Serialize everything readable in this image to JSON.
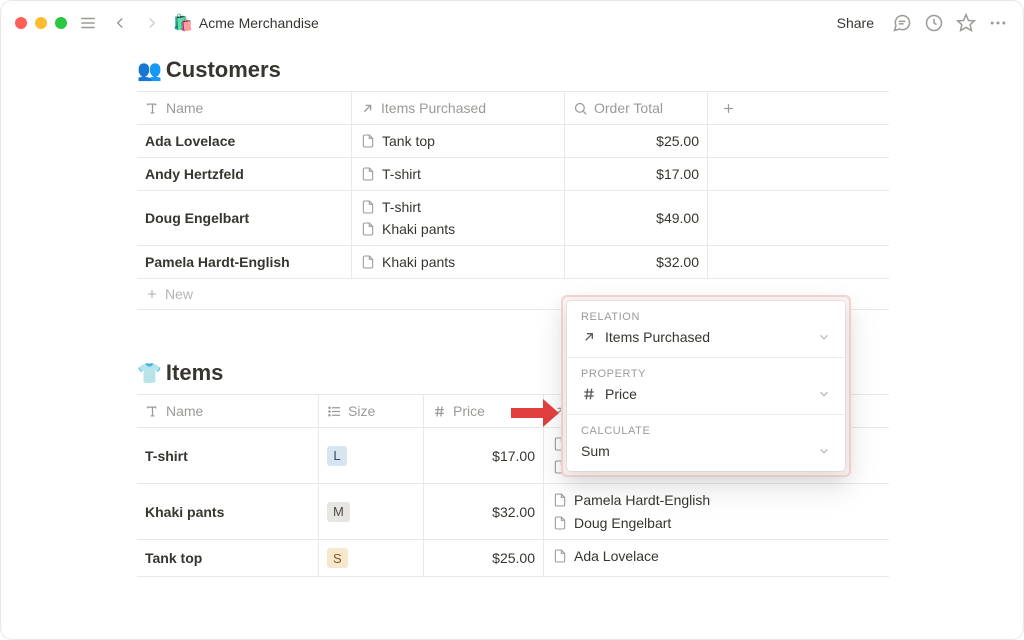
{
  "titlebar": {
    "app_icon": "🛍️",
    "title": "Acme Merchandise",
    "share": "Share"
  },
  "customers": {
    "title_emoji": "👥",
    "title": "Customers",
    "columns": {
      "name": "Name",
      "items": "Items Purchased",
      "order": "Order Total"
    },
    "rows": [
      {
        "name": "Ada Lovelace",
        "items": [
          "Tank top"
        ],
        "total": "$25.00"
      },
      {
        "name": "Andy Hertzfeld",
        "items": [
          "T-shirt"
        ],
        "total": "$17.00"
      },
      {
        "name": "Doug Engelbart",
        "items": [
          "T-shirt",
          "Khaki pants"
        ],
        "total": "$49.00"
      },
      {
        "name": "Pamela Hardt-English",
        "items": [
          "Khaki pants"
        ],
        "total": "$32.00"
      }
    ],
    "new": "New"
  },
  "items": {
    "title_emoji": "👕",
    "title": "Items",
    "columns": {
      "name": "Name",
      "size": "Size",
      "price": "Price"
    },
    "rows": [
      {
        "name": "T-shirt",
        "size": "L",
        "price": "$17.00",
        "purchasers": [
          "",
          ""
        ]
      },
      {
        "name": "Khaki pants",
        "size": "M",
        "price": "$32.00",
        "purchasers": [
          "Pamela Hardt-English",
          "Doug Engelbart"
        ]
      },
      {
        "name": "Tank top",
        "size": "S",
        "price": "$25.00",
        "purchasers": [
          "Ada Lovelace"
        ]
      }
    ]
  },
  "popover": {
    "relation_label": "RELATION",
    "relation_value": "Items Purchased",
    "property_label": "PROPERTY",
    "property_value": "Price",
    "calculate_label": "CALCULATE",
    "calculate_value": "Sum"
  }
}
